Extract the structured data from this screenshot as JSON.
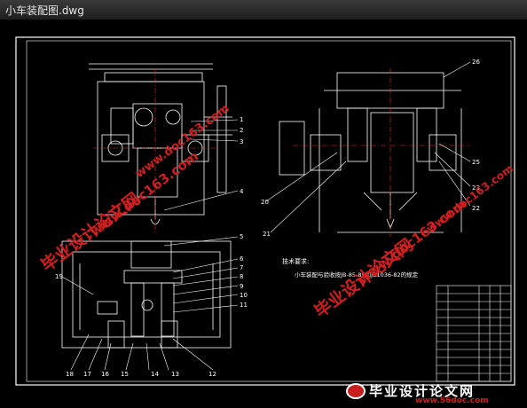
{
  "window": {
    "title": "小车装配图.dwg"
  },
  "drawing": {
    "tech_req_title": "技术要求:",
    "tech_req_text": "小车装配与验收按JB-85-85和JB1036-82的规定",
    "callouts": [
      "1",
      "2",
      "3",
      "4",
      "5",
      "6",
      "7",
      "8",
      "9",
      "10",
      "11",
      "12",
      "13",
      "14",
      "15",
      "16",
      "17",
      "18",
      "19",
      "20",
      "21",
      "22",
      "23",
      "25",
      "26"
    ]
  },
  "watermark": {
    "brand": "毕业设计论文网",
    "site": "www.56doc.com",
    "url_alt": "www.doc163.com"
  },
  "colors": {
    "line": "#ffffff",
    "red": "#ff2a2a",
    "wm": "#d21e1e",
    "bg": "#000000"
  }
}
